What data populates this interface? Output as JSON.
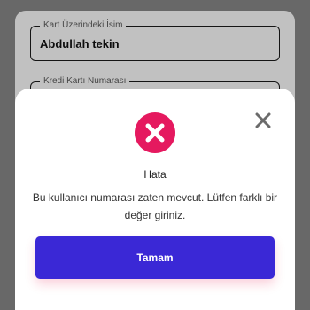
{
  "form": {
    "card_name_label": "Kart Üzerindeki İsim",
    "card_name_value": "Abdullah tekin",
    "card_number_label": "Kredi Kartı Numarası"
  },
  "modal": {
    "title": "Hata",
    "message": "Bu kullanıcı numarası zaten mevcut. Lütfen farklı bir değer giriniz.",
    "ok_label": "Tamam",
    "icons": {
      "status": "error-x-circle-icon",
      "close": "close-icon"
    }
  },
  "colors": {
    "error": "#E5195F",
    "primary_button": "#3A28D6"
  }
}
